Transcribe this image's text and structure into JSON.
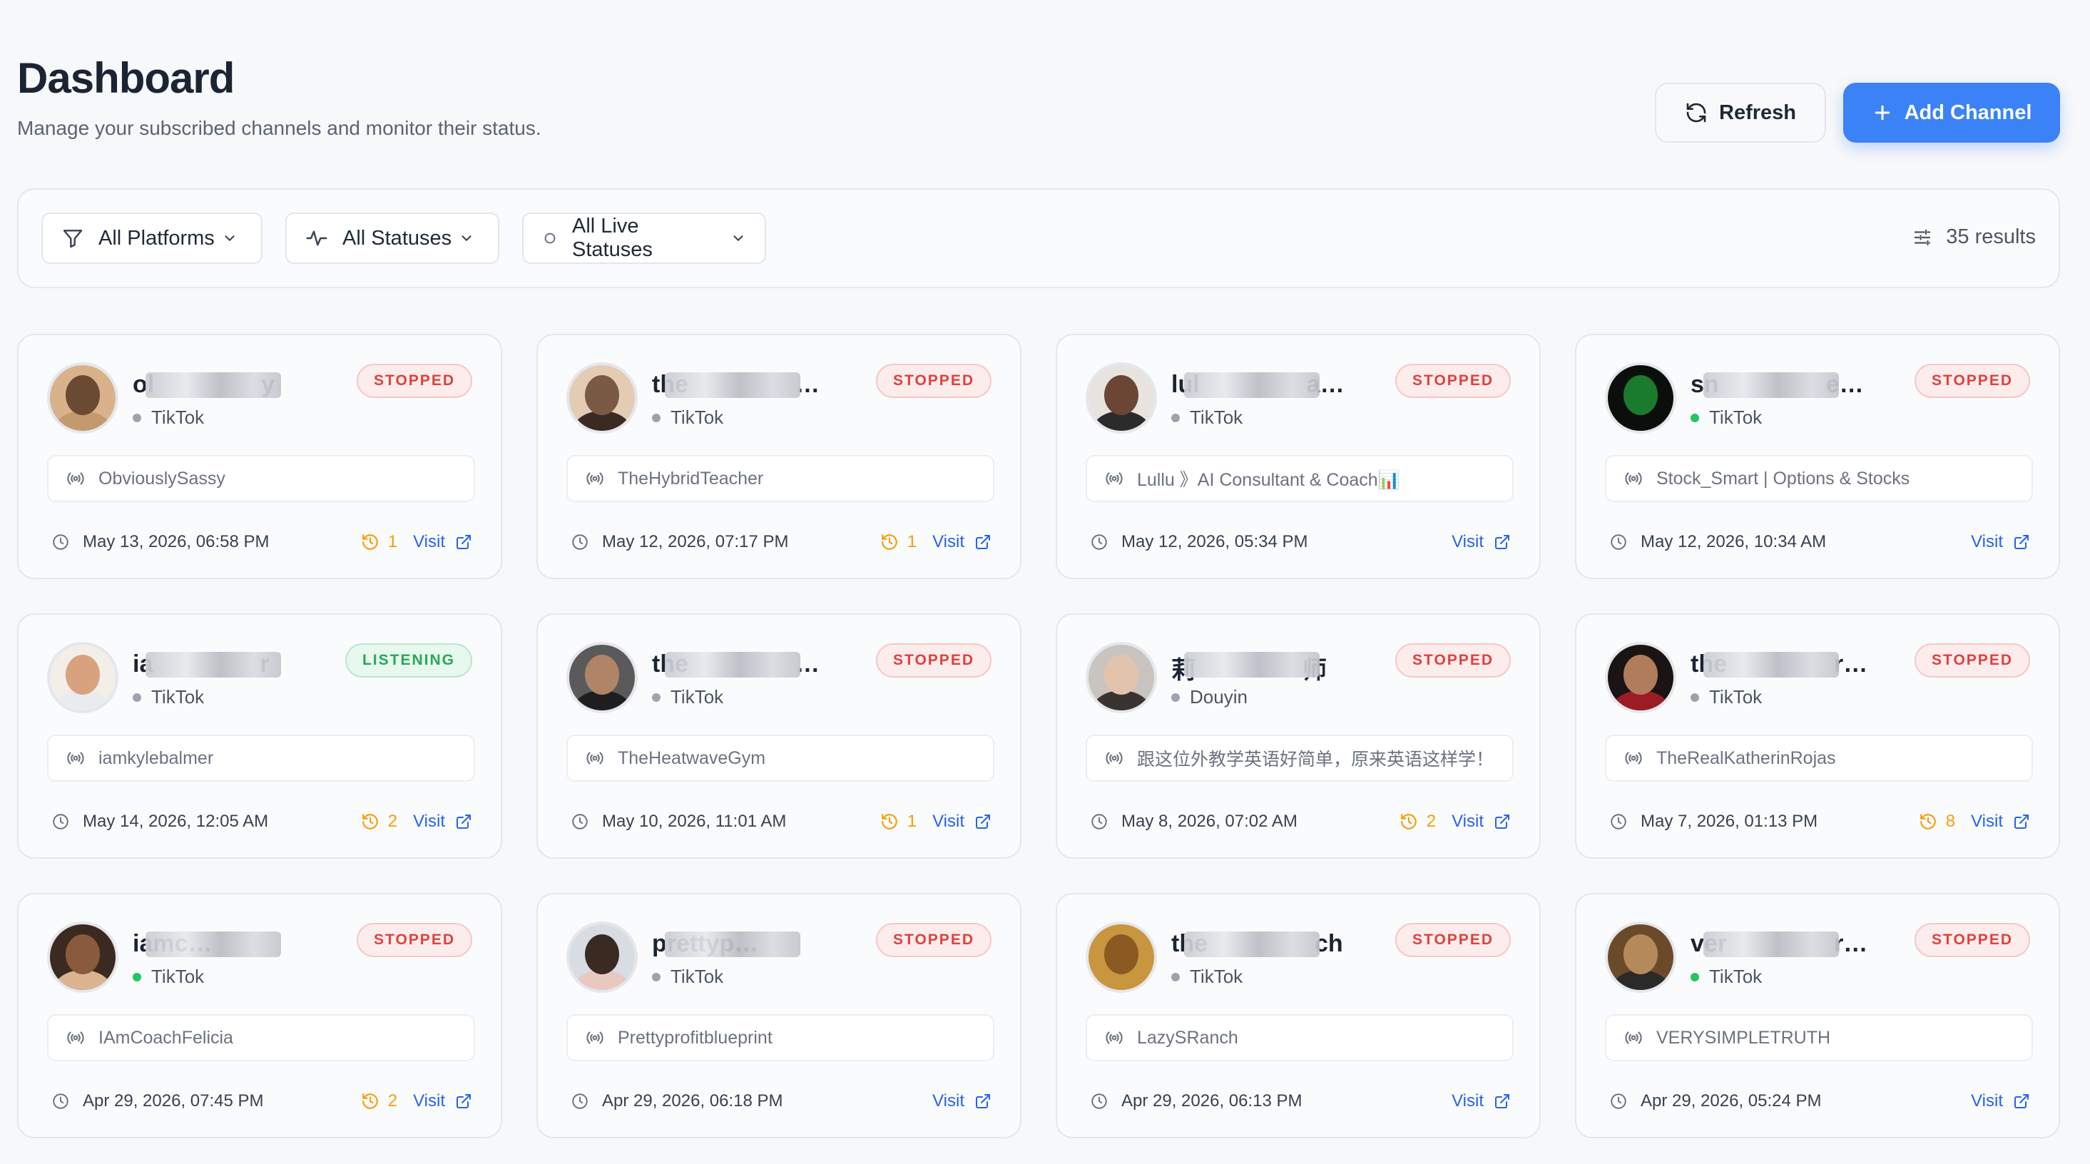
{
  "header": {
    "title": "Dashboard",
    "subtitle": "Manage your subscribed channels and monitor their status."
  },
  "actions": {
    "refresh_label": "Refresh",
    "add_label": "Add Channel"
  },
  "filters": {
    "platforms": "All Platforms",
    "statuses": "All Statuses",
    "live_statuses": "All Live Statuses",
    "results": "35 results"
  },
  "colors": {
    "accent": "#3b82f6",
    "stopped": "#e0413d",
    "listening": "#27a75a",
    "history": "#f59e0b"
  },
  "visit_label": "Visit",
  "cards": [
    {
      "name": "ol",
      "name_tail": "y",
      "status": "STOPPED",
      "platform": "TikTok",
      "live": false,
      "handle": "ObviouslySassy",
      "date": "May 13, 2026, 06:58 PM",
      "count": "1",
      "avatar": [
        "#d9b28c",
        "#6b4a33",
        "#c39a6e"
      ]
    },
    {
      "name": "the",
      "name_tail": "her",
      "status": "STOPPED",
      "platform": "TikTok",
      "live": false,
      "handle": "TheHybridTeacher",
      "date": "May 12, 2026, 07:17 PM",
      "count": "1",
      "avatar": [
        "#e4cbb4",
        "#7a5a44",
        "#3b2a22"
      ]
    },
    {
      "name": "lul",
      "name_tail": "am...",
      "status": "STOPPED",
      "platform": "TikTok",
      "live": false,
      "handle": "Lullu 》AI Consultant & Coach📊",
      "date": "May 12, 2026, 05:34 PM",
      "count": "",
      "avatar": [
        "#e7e3df",
        "#6b4634",
        "#2b2b2b"
      ]
    },
    {
      "name": "sn",
      "name_tail": "e_sto...",
      "status": "STOPPED",
      "platform": "TikTok",
      "live": true,
      "handle": "Stock_Smart | Options & Stocks",
      "date": "May 12, 2026, 10:34 AM",
      "count": "",
      "avatar": [
        "#0b0f0c",
        "#1a7a2e",
        "#0b0f0c"
      ]
    },
    {
      "name": "ia",
      "name_tail": "r",
      "status": "LISTENING",
      "platform": "TikTok",
      "live": false,
      "handle": "iamkylebalmer",
      "date": "May 14, 2026, 12:05 AM",
      "count": "2",
      "avatar": [
        "#f3eee8",
        "#d9a27f",
        "#e9ecef"
      ]
    },
    {
      "name": "the",
      "name_tail": "ym",
      "status": "STOPPED",
      "platform": "TikTok",
      "live": false,
      "handle": "TheHeatwaveGym",
      "date": "May 10, 2026, 11:01 AM",
      "count": "1",
      "avatar": [
        "#5a5a5a",
        "#b08466",
        "#1e1e1e"
      ]
    },
    {
      "name": "莉",
      "name_tail": "师",
      "status": "STOPPED",
      "platform": "Douyin",
      "live": false,
      "handle": "跟这位外教学英语好简单，原来英语这样学！",
      "date": "May 8, 2026, 07:02 AM",
      "count": "2",
      "avatar": [
        "#c9c4bf",
        "#e2c4ad",
        "#3a3330"
      ]
    },
    {
      "name": "the",
      "name_tail": "rinr...",
      "status": "STOPPED",
      "platform": "TikTok",
      "live": false,
      "handle": "TheRealKatherinRojas",
      "date": "May 7, 2026, 01:13 PM",
      "count": "8",
      "avatar": [
        "#1b1414",
        "#b07c5c",
        "#9b1c24"
      ]
    },
    {
      "name": "iamc",
      "name_tail": "icia",
      "status": "STOPPED",
      "platform": "TikTok",
      "live": true,
      "handle": "IAmCoachFelicia",
      "date": "Apr 29, 2026, 07:45 PM",
      "count": "2",
      "avatar": [
        "#3a2a22",
        "#8a5a3c",
        "#d9b48f"
      ]
    },
    {
      "name": "prettyp",
      "name_tail": "o",
      "status": "STOPPED",
      "platform": "TikTok",
      "live": false,
      "handle": "Prettyprofitblueprint",
      "date": "Apr 29, 2026, 06:18 PM",
      "count": "",
      "avatar": [
        "#d7dde3",
        "#3a2a22",
        "#e8c9c1"
      ]
    },
    {
      "name": "the",
      "name_tail": "ch",
      "status": "STOPPED",
      "platform": "TikTok",
      "live": false,
      "handle": "LazySRanch",
      "date": "Apr 29, 2026, 06:13 PM",
      "count": "",
      "avatar": [
        "#c8963e",
        "#8a5a22",
        "#c8963e"
      ]
    },
    {
      "name": "ver",
      "name_tail": "ruth9",
      "status": "STOPPED",
      "platform": "TikTok",
      "live": true,
      "handle": "VERYSIMPLETRUTH",
      "date": "Apr 29, 2026, 05:24 PM",
      "count": "",
      "avatar": [
        "#6b4a2a",
        "#b48a5a",
        "#2a2a2a"
      ]
    }
  ]
}
